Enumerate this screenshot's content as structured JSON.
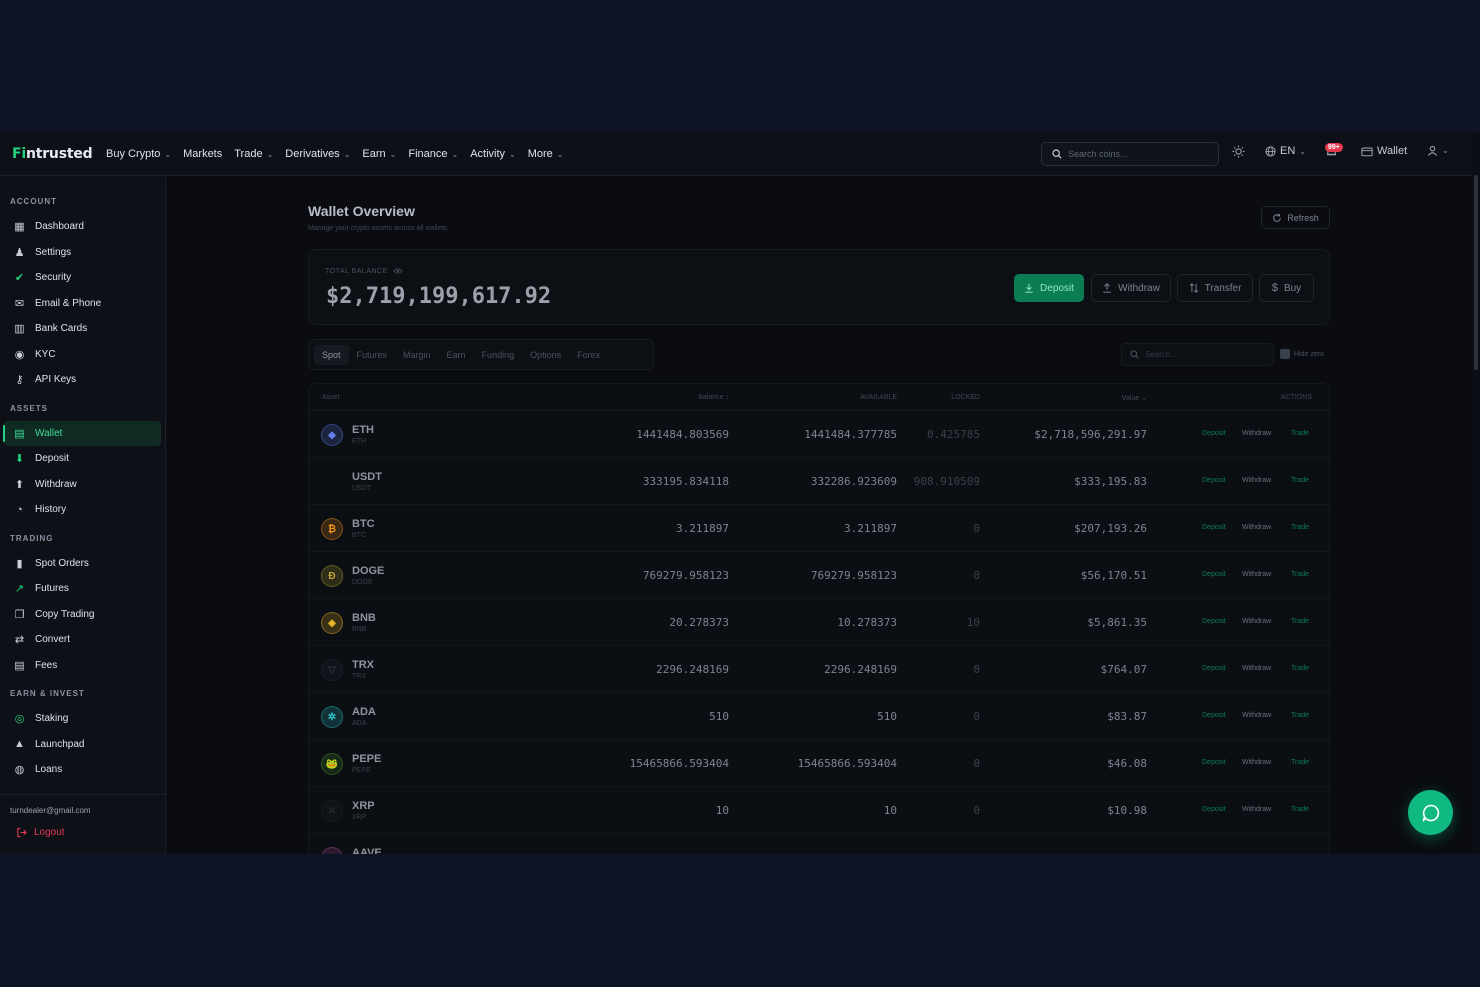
{
  "app": {
    "logo_accent": "Fi",
    "logo_rest": "ntrusted"
  },
  "nav": {
    "items": [
      {
        "label": "Buy Crypto",
        "dropdown": true
      },
      {
        "label": "Markets",
        "dropdown": false
      },
      {
        "label": "Trade",
        "dropdown": true
      },
      {
        "label": "Derivatives",
        "dropdown": true
      },
      {
        "label": "Earn",
        "dropdown": true
      },
      {
        "label": "Finance",
        "dropdown": true
      },
      {
        "label": "Activity",
        "dropdown": true
      },
      {
        "label": "More",
        "dropdown": true
      }
    ],
    "search_placeholder": "Search coins...",
    "language": "EN",
    "notif_badge": "99+",
    "wallet_label": "Wallet"
  },
  "sidebar": {
    "sections": [
      {
        "title": "ACCOUNT",
        "items": [
          {
            "label": "Dashboard",
            "icon": "grid-icon"
          },
          {
            "label": "Settings",
            "icon": "user-icon"
          },
          {
            "label": "Security",
            "icon": "shield-check-icon"
          },
          {
            "label": "Email & Phone",
            "icon": "mail-icon"
          },
          {
            "label": "Bank Cards",
            "icon": "bank-icon"
          },
          {
            "label": "KYC",
            "icon": "id-icon"
          },
          {
            "label": "API Keys",
            "icon": "key-icon"
          }
        ]
      },
      {
        "title": "ASSETS",
        "items": [
          {
            "label": "Wallet",
            "icon": "wallet-icon",
            "active": true
          },
          {
            "label": "Deposit",
            "icon": "deposit-icon"
          },
          {
            "label": "Withdraw",
            "icon": "withdraw-icon"
          },
          {
            "label": "History",
            "icon": "clock-icon"
          }
        ]
      },
      {
        "title": "TRADING",
        "items": [
          {
            "label": "Spot Orders",
            "icon": "bar-chart-icon"
          },
          {
            "label": "Futures",
            "icon": "trend-icon"
          },
          {
            "label": "Copy Trading",
            "icon": "copy-icon"
          },
          {
            "label": "Convert",
            "icon": "swap-icon"
          },
          {
            "label": "Fees",
            "icon": "receipt-icon"
          }
        ]
      },
      {
        "title": "EARN & INVEST",
        "items": [
          {
            "label": "Staking",
            "icon": "coin-icon"
          },
          {
            "label": "Launchpad",
            "icon": "rocket-icon"
          },
          {
            "label": "Loans",
            "icon": "loan-icon"
          }
        ]
      }
    ],
    "email": "turndealer@gmail.com",
    "logout": "Logout"
  },
  "main": {
    "title": "Wallet Overview",
    "subtitle": "Manage your crypto assets across all wallets",
    "refresh": "Refresh",
    "balance_label": "TOTAL BALANCE",
    "balance": "$2,719,199,617.92",
    "actions": {
      "deposit": "Deposit",
      "withdraw": "Withdraw",
      "transfer": "Transfer",
      "buy": "Buy"
    },
    "tabs": [
      "Spot",
      "Futures",
      "Margin",
      "Earn",
      "Funding",
      "Options",
      "Forex"
    ],
    "active_tab": "Spot",
    "table_search_placeholder": "Search...",
    "hide_zero": "Hide zero",
    "columns": {
      "asset": "Asset",
      "balance": "Balance",
      "available": "AVAILABLE",
      "locked": "LOCKED",
      "value": "Value",
      "actions": "ACTIONS"
    },
    "row_actions": {
      "deposit": "Deposit",
      "withdraw": "Withdraw",
      "trade": "Trade"
    },
    "rows": [
      {
        "symbol": "ETH",
        "sub": "ETH",
        "balance": "1441484.803569",
        "available": "1441484.377785",
        "locked": "0.425785",
        "value": "$2,718,596,291.97",
        "color": "#627eea",
        "glyph": "◆"
      },
      {
        "symbol": "USDT",
        "sub": "USDT",
        "balance": "333195.834118",
        "available": "332286.923609",
        "locked": "908.910509",
        "value": "$333,195.83",
        "color": "",
        "glyph": ""
      },
      {
        "symbol": "BTC",
        "sub": "BTC",
        "balance": "3.211897",
        "available": "3.211897",
        "locked": "0",
        "value": "$207,193.26",
        "color": "#f7931a",
        "glyph": "₿"
      },
      {
        "symbol": "DOGE",
        "sub": "DOGE",
        "balance": "769279.958123",
        "available": "769279.958123",
        "locked": "0",
        "value": "$56,170.51",
        "color": "#c2a633",
        "glyph": "Ð"
      },
      {
        "symbol": "BNB",
        "sub": "BNB",
        "balance": "20.278373",
        "available": "10.278373",
        "locked": "10",
        "value": "$5,861.35",
        "color": "#f3ba2f",
        "glyph": "◈"
      },
      {
        "symbol": "TRX",
        "sub": "TRX",
        "balance": "2296.248169",
        "available": "2296.248169",
        "locked": "0",
        "value": "$764.07",
        "color": "#2a2f38",
        "glyph": "▽"
      },
      {
        "symbol": "ADA",
        "sub": "ADA",
        "balance": "510",
        "available": "510",
        "locked": "0",
        "value": "$83.87",
        "color": "#2ec4c4",
        "glyph": "✲"
      },
      {
        "symbol": "PEPE",
        "sub": "PEPE",
        "balance": "15465866.593404",
        "available": "15465866.593404",
        "locked": "0",
        "value": "$46.08",
        "color": "#4c9a2a",
        "glyph": "🐸"
      },
      {
        "symbol": "XRP",
        "sub": "XRP",
        "balance": "10",
        "available": "10",
        "locked": "0",
        "value": "$10.98",
        "color": "#23272f",
        "glyph": "✕"
      },
      {
        "symbol": "AAVE",
        "sub": "",
        "balance": "",
        "available": "",
        "locked": "",
        "value": "",
        "color": "#b6509e",
        "glyph": ""
      }
    ]
  }
}
